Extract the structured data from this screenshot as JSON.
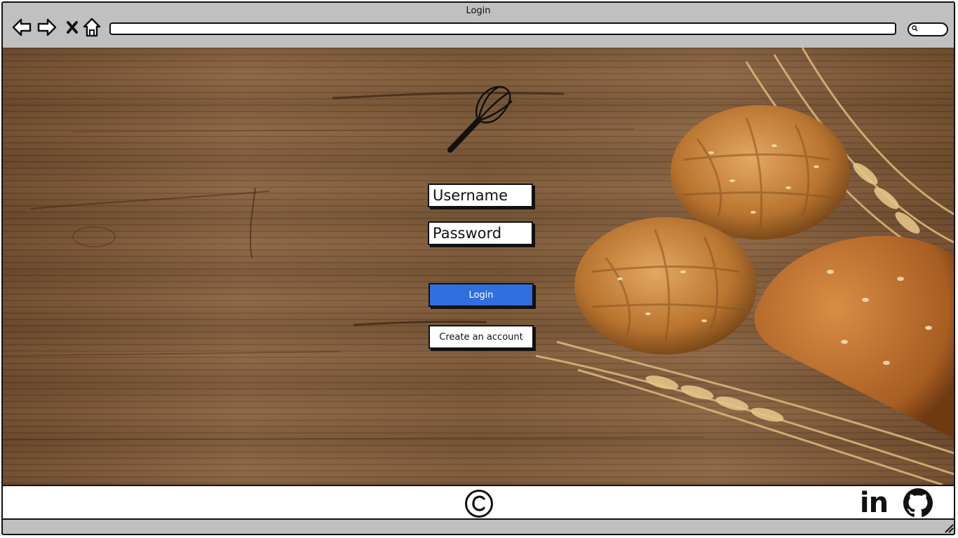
{
  "window": {
    "title": "Login"
  },
  "navbar": {
    "back_icon": "back-arrow-icon",
    "forward_icon": "forward-arrow-icon",
    "stop_icon": "close-icon",
    "home_icon": "home-icon",
    "url": "",
    "search_icon": "search-icon"
  },
  "login": {
    "logo_icon": "whisk-icon",
    "username_placeholder": "Username",
    "password_placeholder": "Password",
    "login_label": "Login",
    "create_account_label": "Create an account"
  },
  "footer": {
    "copyright_icon": "copyright-icon",
    "links": [
      {
        "icon": "linkedin-icon",
        "text": "in"
      },
      {
        "icon": "github-icon"
      }
    ]
  },
  "colors": {
    "primary_button": "#2f6fde",
    "chrome": "#c0c0c0",
    "wood": "#7b5838"
  }
}
